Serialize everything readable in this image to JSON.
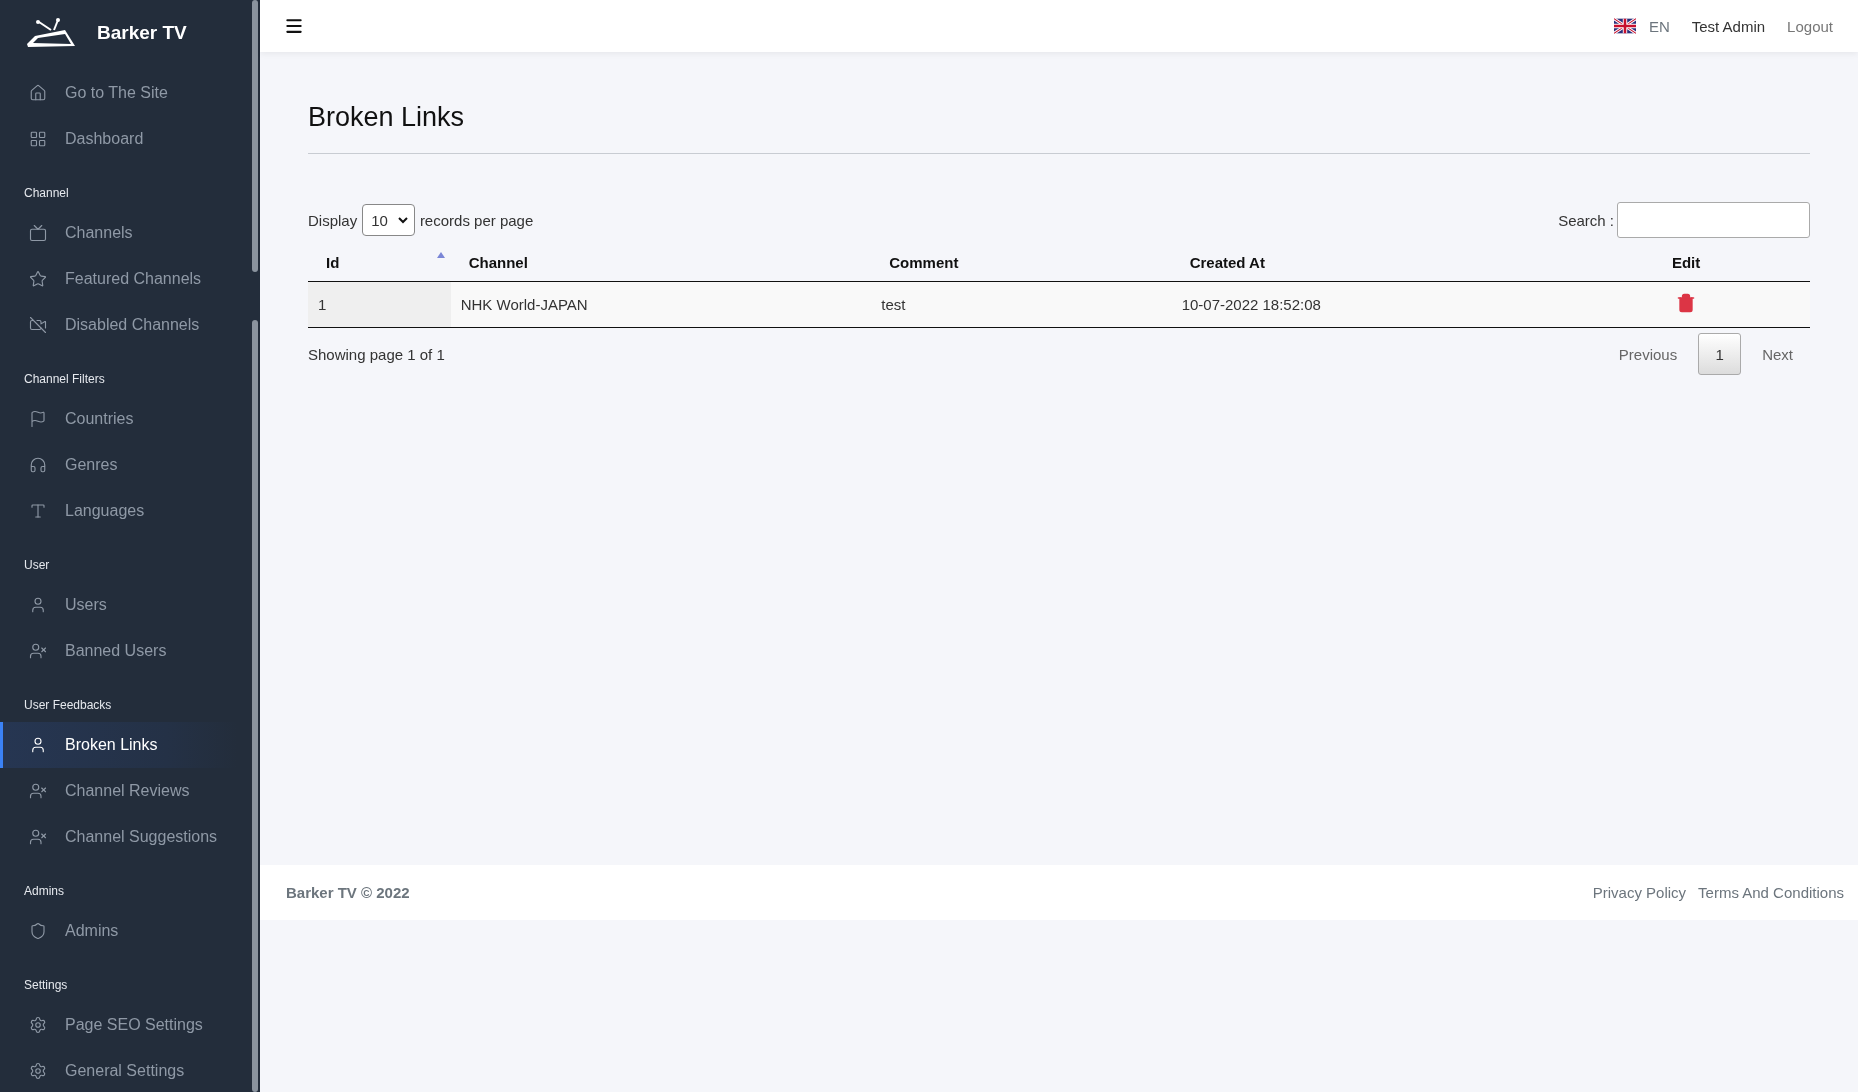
{
  "sidebar": {
    "brand": "Barker TV",
    "top_items": [
      {
        "label": "Go to The Site",
        "selected": false
      },
      {
        "label": "Dashboard",
        "selected": false
      }
    ],
    "sections": [
      {
        "title": "Channel",
        "items": [
          {
            "label": "Channels",
            "selected": false
          },
          {
            "label": "Featured Channels",
            "selected": false
          },
          {
            "label": "Disabled Channels",
            "selected": false
          }
        ]
      },
      {
        "title": "Channel Filters",
        "items": [
          {
            "label": "Countries",
            "selected": false
          },
          {
            "label": "Genres",
            "selected": false
          },
          {
            "label": "Languages",
            "selected": false
          }
        ]
      },
      {
        "title": "User",
        "items": [
          {
            "label": "Users",
            "selected": false
          },
          {
            "label": "Banned Users",
            "selected": false
          }
        ]
      },
      {
        "title": "User Feedbacks",
        "items": [
          {
            "label": "Broken Links",
            "selected": true
          },
          {
            "label": "Channel Reviews",
            "selected": false
          },
          {
            "label": "Channel Suggestions",
            "selected": false
          }
        ]
      },
      {
        "title": "Admins",
        "items": [
          {
            "label": "Admins",
            "selected": false
          }
        ]
      },
      {
        "title": "Settings",
        "items": [
          {
            "label": "Page SEO Settings",
            "selected": false
          },
          {
            "label": "General Settings",
            "selected": false
          }
        ]
      }
    ]
  },
  "topbar": {
    "language": "EN",
    "user": "Test Admin",
    "logout": "Logout"
  },
  "page": {
    "title": "Broken Links",
    "per_page": {
      "before": "Display",
      "value": "10",
      "after": "records per page"
    },
    "search": {
      "label": "Search :"
    },
    "table": {
      "columns": [
        {
          "label": "Id",
          "sorted": true
        },
        {
          "label": "Channel",
          "sorted": false
        },
        {
          "label": "Comment",
          "sorted": false
        },
        {
          "label": "Created At",
          "sorted": false
        },
        {
          "label": "Edit",
          "sorted": false
        }
      ],
      "rows": [
        {
          "id": "1",
          "channel": "NHK World-JAPAN",
          "comment": "test",
          "created_at": "10-07-2022 18:52:08"
        }
      ]
    },
    "summary": "Showing page 1 of 1",
    "pagination": {
      "previous": "Previous",
      "pages": [
        {
          "label": "1",
          "selected": true
        }
      ],
      "next": "Next"
    }
  },
  "footer": {
    "copyright": "Barker TV © 2022",
    "links": [
      "Privacy Policy",
      "Terms And Conditions"
    ]
  }
}
